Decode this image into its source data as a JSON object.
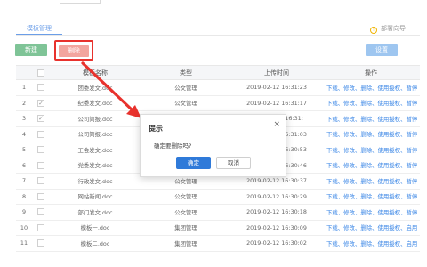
{
  "tab": {
    "label": "模板管理"
  },
  "guide": {
    "label": "部署向导"
  },
  "toolbar": {
    "new_label": "新建",
    "delete_label": "删除",
    "settings_label": "设置"
  },
  "table": {
    "columns": [
      "",
      "",
      "模板名称",
      "类型",
      "上传时间",
      "操作"
    ],
    "rows": [
      {
        "index": "1",
        "checked": false,
        "name": "团委发文.doc",
        "type": "公文管理",
        "time": "2019-02-12 16:31:23",
        "ops": "下载、修改、删除、使用授权、暂停"
      },
      {
        "index": "2",
        "checked": true,
        "name": "纪委发文.doc",
        "type": "公文管理",
        "time": "2019-02-12 16:31:17",
        "ops": "下载、修改、删除、使用授权、暂停"
      },
      {
        "index": "3",
        "checked": true,
        "name": "公司简报.doc",
        "type": "公文管理",
        "time": "2019-02-12 16:31:",
        "ops": "下载、修改、删除、使用授权、暂停"
      },
      {
        "index": "4",
        "checked": false,
        "name": "公司简报.doc",
        "type": "公文管理",
        "time": "2019-02-12 16:31:03",
        "ops": "下载、修改、删除、使用授权、暂停"
      },
      {
        "index": "5",
        "checked": false,
        "name": "工会发文.doc",
        "type": "公文管理",
        "time": "2019-02-12 16:30:53",
        "ops": "下载、修改、删除、使用授权、暂停"
      },
      {
        "index": "6",
        "checked": false,
        "name": "党委发文.doc",
        "type": "公文管理",
        "time": "2019-02-12 16:30:46",
        "ops": "下载、修改、删除、使用授权、暂停"
      },
      {
        "index": "7",
        "checked": false,
        "name": "行政发文.doc",
        "type": "公文管理",
        "time": "2019-02-12 16:30:37",
        "ops": "下载、修改、删除、使用授权、暂停"
      },
      {
        "index": "8",
        "checked": false,
        "name": "网站新闻.doc",
        "type": "公文管理",
        "time": "2019-02-12 16:30:29",
        "ops": "下载、修改、删除、使用授权、暂停"
      },
      {
        "index": "9",
        "checked": false,
        "name": "部门发文.doc",
        "type": "公文管理",
        "time": "2019-02-12 16:30:18",
        "ops": "下载、修改、删除、使用授权、暂停"
      },
      {
        "index": "10",
        "checked": false,
        "name": "模板一.doc",
        "type": "集团管理",
        "time": "2019-02-12 16:30:09",
        "ops": "下载、修改、删除、使用授权、启用"
      },
      {
        "index": "11",
        "checked": false,
        "name": "模板二.doc",
        "type": "集团管理",
        "time": "2019-02-12 16:30:02",
        "ops": "下载、修改、删除、使用授权、启用"
      }
    ]
  },
  "dialog": {
    "title": "提示",
    "message": "确定要删除吗?",
    "ok_label": "确定",
    "cancel_label": "取消",
    "close_glyph": "×"
  },
  "colors": {
    "accent": "#6b9ee8",
    "new": "#7fc497",
    "delete": "#f3a59e",
    "settings": "#9ec6f0",
    "highlight": "#e8322d",
    "primary": "#2f7ad9"
  },
  "icons": {
    "guide": "info-icon",
    "dialog_close": "close-icon",
    "annotation": "red-arrow"
  }
}
